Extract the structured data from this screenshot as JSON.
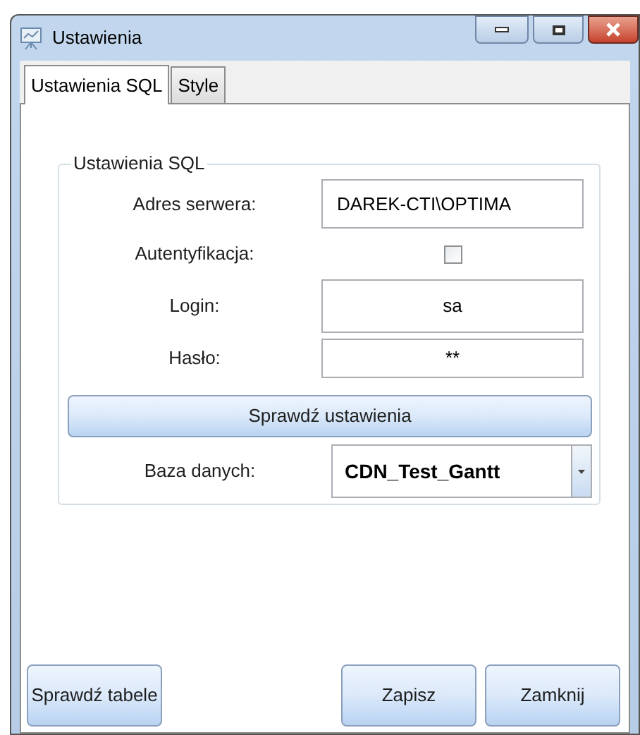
{
  "window": {
    "title": "Ustawienia"
  },
  "tabs": [
    {
      "label": "Ustawienia SQL",
      "selected": true
    },
    {
      "label": "Style",
      "selected": false
    }
  ],
  "group": {
    "title": "Ustawienia SQL",
    "fields": [
      {
        "kind": "text",
        "label": "Adres serwera:",
        "value": "DAREK-CTI\\OPTIMA"
      },
      {
        "kind": "checkbox",
        "label": "Autentyfikacja:",
        "checked": false
      },
      {
        "kind": "centered",
        "label": "Login:",
        "value": "sa"
      },
      {
        "kind": "centered",
        "label": "Hasło:",
        "value": "**"
      }
    ],
    "check_button": "Sprawdź ustawienia",
    "database": {
      "label": "Baza danych:",
      "value": "CDN_Test_Gantt"
    }
  },
  "buttons": [
    {
      "label": "Sprawdź tabele"
    },
    {
      "label": "Zapisz"
    },
    {
      "label": "Zamknij"
    }
  ]
}
